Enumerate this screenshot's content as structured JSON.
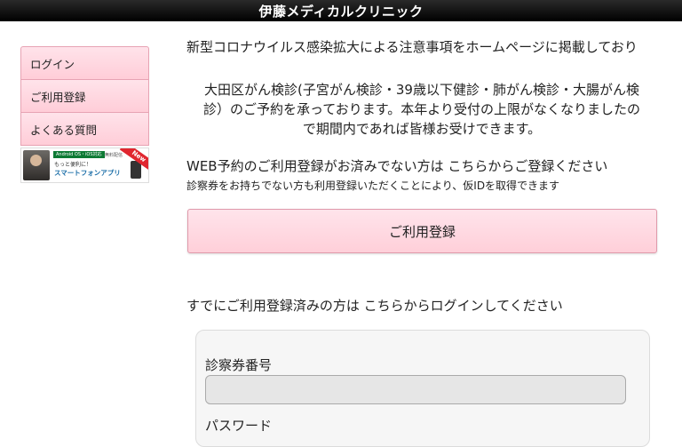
{
  "header": {
    "title": "伊藤メディカルクリニック"
  },
  "sidebar": {
    "items": [
      {
        "label": "ログイン"
      },
      {
        "label": "ご利用登録"
      },
      {
        "label": "よくある質問"
      }
    ],
    "banner": {
      "tag": "Android OS・iOS対応",
      "tag2": "無料配信",
      "sub": "もっと便利に！",
      "main": "スマートフォンアプリ",
      "new_badge": "New"
    }
  },
  "main": {
    "notice": "新型コロナウイルス感染拡大による注意事項をホームページに掲載しており",
    "notice2_line1": "大田区がん検診(子宮がん検診・39歳以下健診・肺がん検診・大腸がん検",
    "notice2_line2": "診）のご予約を承っております。本年より受付の上限がなくなりましたの",
    "notice2_line3": "で期間内であれば皆様お受けできます。",
    "web_title": "WEB予約のご利用登録がお済みでない方は こちらからご登録ください",
    "web_sub": "診察券をお持ちでない方も利用登録いただくことにより、仮IDを取得できます",
    "register_button": "ご利用登録",
    "login_title": "すでにご利用登録済みの方は こちらからログインしてください",
    "login_form": {
      "card_label": "診察券番号",
      "card_value": "",
      "password_label": "パスワード"
    }
  }
}
